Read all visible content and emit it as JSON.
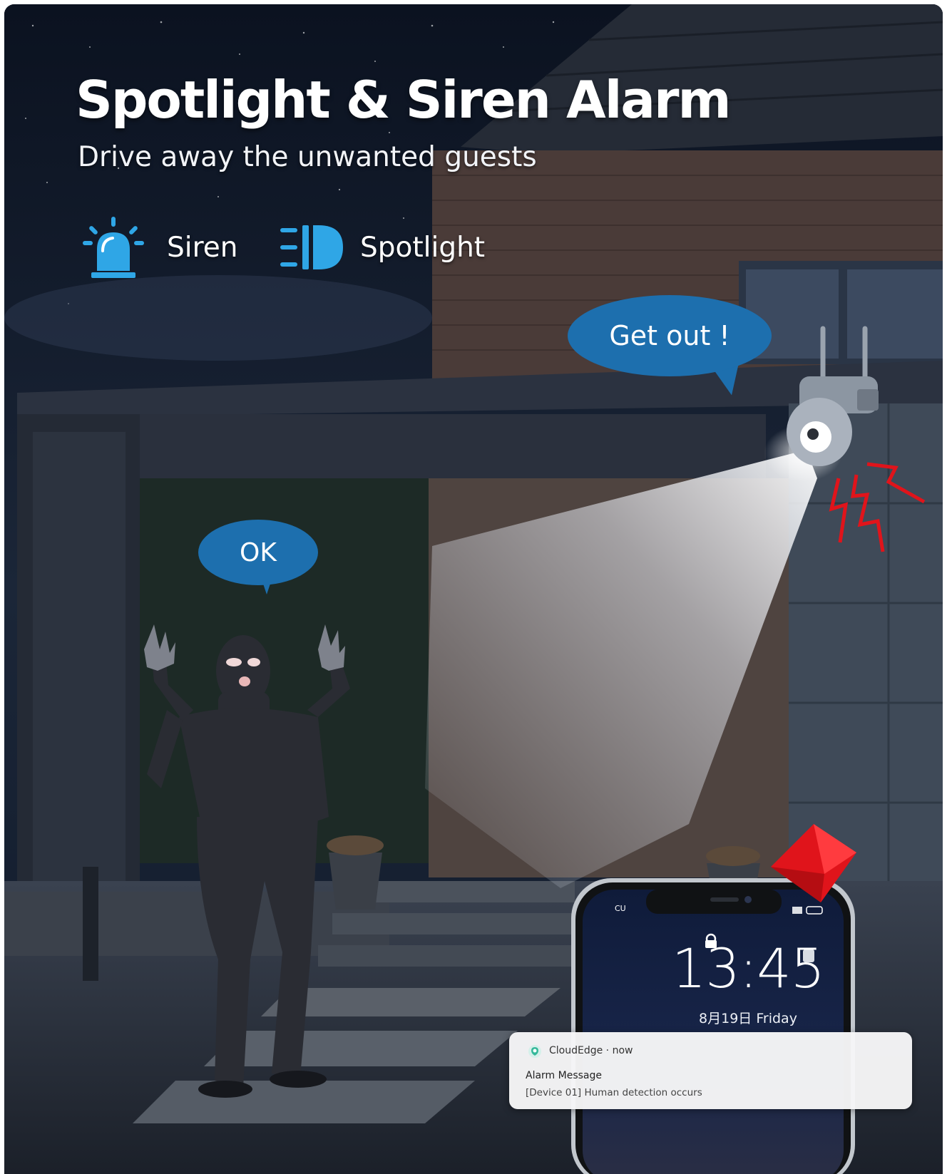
{
  "headline": "Spotlight & Siren Alarm",
  "subheadline": "Drive away the unwanted guests",
  "features": [
    {
      "label": "Siren",
      "icon": "siren-icon"
    },
    {
      "label": "Spotlight",
      "icon": "spotlight-icon"
    }
  ],
  "bubbles": {
    "camera": "Get out !",
    "person": "OK"
  },
  "phone": {
    "carrier": "CU",
    "time": "13:45",
    "date": "8月19日 Friday",
    "notification": {
      "app": "CloudEdge · now",
      "title": "Alarm Message",
      "body": "[Device 01] Human detection occurs"
    }
  },
  "colors": {
    "accent_blue": "#1d6fae",
    "icon_blue": "#2fa6e6",
    "alert_red": "#e0141b"
  }
}
